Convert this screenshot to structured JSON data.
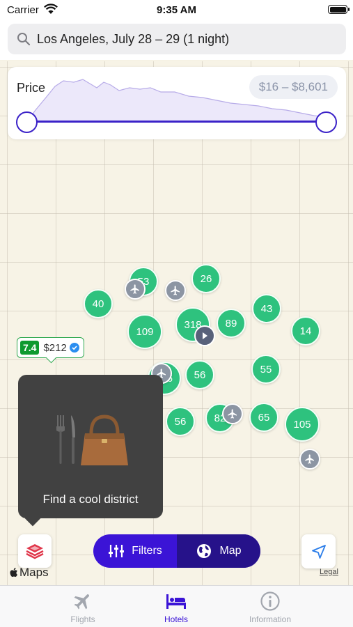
{
  "status_bar": {
    "carrier": "Carrier",
    "time": "9:35 AM"
  },
  "search": {
    "query": "Los Angeles, July 28 – 29 (1 night)"
  },
  "price_filter": {
    "title": "Price",
    "range_label": "$16 – $8,601",
    "min_fraction": 0,
    "max_fraction": 1
  },
  "map": {
    "clusters": [
      "40",
      "53",
      "26",
      "109",
      "318",
      "89",
      "43",
      "14",
      "56",
      "56",
      "55",
      "56",
      "82",
      "65",
      "105"
    ],
    "hotel_tag": {
      "rating": "7.4",
      "price": "$212"
    },
    "tooltip": "Find a cool district",
    "maps_logo": "Maps",
    "legal": "Legal"
  },
  "toggle": {
    "filters_label": "Filters",
    "map_label": "Map",
    "selected": "Map"
  },
  "tabs": [
    {
      "label": "Flights",
      "icon": "airplane-icon"
    },
    {
      "label": "Hotels",
      "icon": "bed-icon"
    },
    {
      "label": "Information",
      "icon": "info-icon"
    }
  ],
  "colors": {
    "accent": "#3b14d6",
    "cluster": "#2ec27e",
    "rating": "#0e9a2f"
  }
}
